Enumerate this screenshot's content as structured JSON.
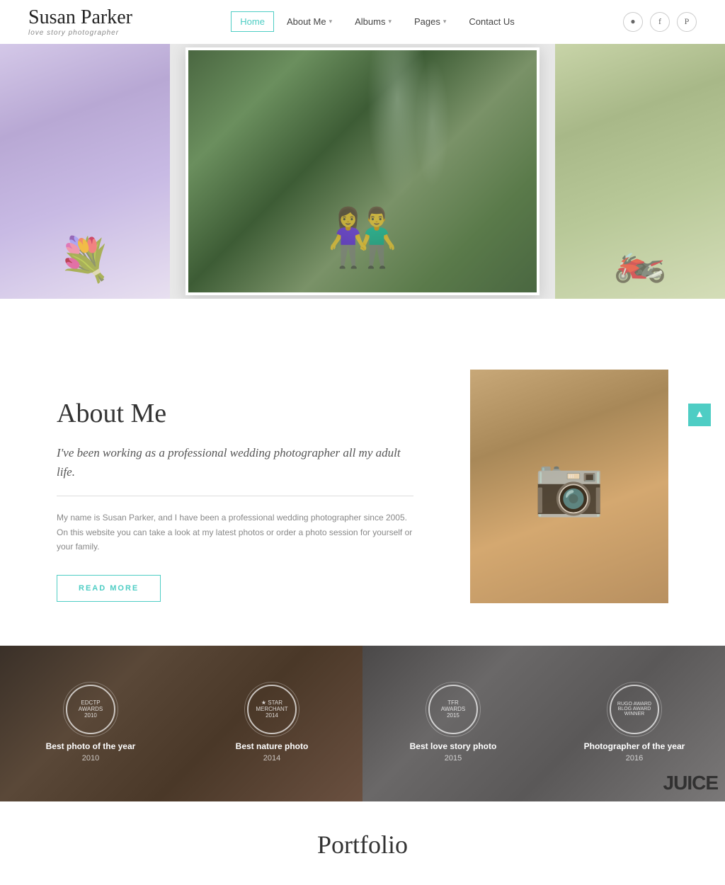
{
  "site": {
    "name": "Susan Parker",
    "tagline": "love story photographer"
  },
  "nav": {
    "items": [
      {
        "label": "Home",
        "active": true,
        "has_dropdown": false
      },
      {
        "label": "About Me",
        "active": false,
        "has_dropdown": true
      },
      {
        "label": "Albums",
        "active": false,
        "has_dropdown": true
      },
      {
        "label": "Pages",
        "active": false,
        "has_dropdown": true
      },
      {
        "label": "Contact Us",
        "active": false,
        "has_dropdown": false
      }
    ]
  },
  "social": {
    "instagram": "instagram-icon",
    "facebook": "facebook-icon",
    "pinterest": "pinterest-icon"
  },
  "about": {
    "title": "About Me",
    "tagline": "I've been working as a professional wedding photographer all my adult life.",
    "description": "My name is Susan Parker, and I have been a professional wedding photographer since 2005. On this website you can take a look at my latest photos or order a photo session for yourself or your family.",
    "read_more": "READ MORE"
  },
  "awards": [
    {
      "name": "Best photo of the year",
      "year": "2010",
      "badge": "EDCTP\nAWARDS\n2010"
    },
    {
      "name": "Best nature photo",
      "year": "2014",
      "badge": "STAR\nMERCHANT\n2014"
    },
    {
      "name": "Best love story photo",
      "year": "2015",
      "badge": "TFR\nAWARDS\n2015"
    },
    {
      "name": "Photographer of the year",
      "year": "2016",
      "badge": "RUGO AWARD\nBLOG AWARD\nWINNER"
    }
  ],
  "portfolio": {
    "title": "Portfolio"
  },
  "scroll_up": "▲"
}
